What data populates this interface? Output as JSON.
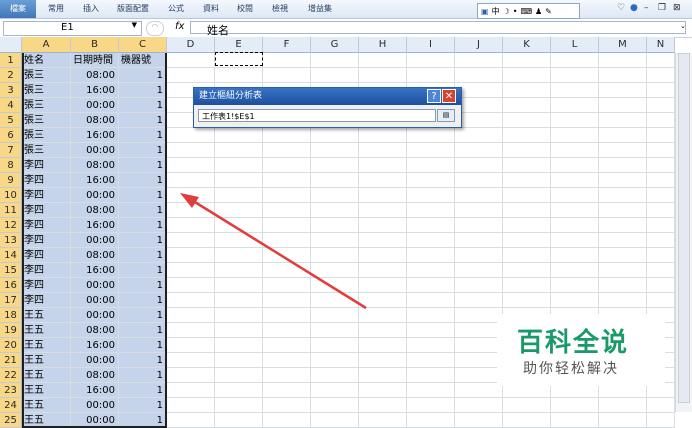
{
  "ribbon": {
    "file_tab": "檔案",
    "tabs": [
      "常用",
      "插入",
      "版面配置",
      "公式",
      "資料",
      "校閱",
      "檢視",
      "增益集"
    ],
    "ime_text": "中"
  },
  "formula_bar": {
    "name_box": "E1",
    "fx": "fx",
    "formula": "姓名"
  },
  "columns": [
    "A",
    "B",
    "C",
    "D",
    "E",
    "F",
    "G",
    "H",
    "I",
    "J",
    "K",
    "L",
    "M",
    "N"
  ],
  "rows": [
    {
      "num": "1",
      "name": "姓名",
      "time": "日期時間",
      "machine": "機器號"
    },
    {
      "num": "2",
      "name": "張三",
      "time": "08:00",
      "machine": "1"
    },
    {
      "num": "3",
      "name": "張三",
      "time": "16:00",
      "machine": "1"
    },
    {
      "num": "4",
      "name": "張三",
      "time": "00:00",
      "machine": "1"
    },
    {
      "num": "5",
      "name": "張三",
      "time": "08:00",
      "machine": "1"
    },
    {
      "num": "6",
      "name": "張三",
      "time": "16:00",
      "machine": "1"
    },
    {
      "num": "7",
      "name": "張三",
      "time": "00:00",
      "machine": "1"
    },
    {
      "num": "8",
      "name": "李四",
      "time": "08:00",
      "machine": "1"
    },
    {
      "num": "9",
      "name": "李四",
      "time": "16:00",
      "machine": "1"
    },
    {
      "num": "10",
      "name": "李四",
      "time": "00:00",
      "machine": "1"
    },
    {
      "num": "11",
      "name": "李四",
      "time": "08:00",
      "machine": "1"
    },
    {
      "num": "12",
      "name": "李四",
      "time": "16:00",
      "machine": "1"
    },
    {
      "num": "13",
      "name": "李四",
      "time": "00:00",
      "machine": "1"
    },
    {
      "num": "14",
      "name": "李四",
      "time": "08:00",
      "machine": "1"
    },
    {
      "num": "15",
      "name": "李四",
      "time": "16:00",
      "machine": "1"
    },
    {
      "num": "16",
      "name": "李四",
      "time": "00:00",
      "machine": "1"
    },
    {
      "num": "17",
      "name": "李四",
      "time": "00:00",
      "machine": "1"
    },
    {
      "num": "18",
      "name": "王五",
      "time": "00:00",
      "machine": "1"
    },
    {
      "num": "19",
      "name": "王五",
      "time": "08:00",
      "machine": "1"
    },
    {
      "num": "20",
      "name": "王五",
      "time": "16:00",
      "machine": "1"
    },
    {
      "num": "21",
      "name": "王五",
      "time": "00:00",
      "machine": "1"
    },
    {
      "num": "22",
      "name": "王五",
      "time": "08:00",
      "machine": "1"
    },
    {
      "num": "23",
      "name": "王五",
      "time": "16:00",
      "machine": "1"
    },
    {
      "num": "24",
      "name": "王五",
      "time": "00:00",
      "machine": "1"
    },
    {
      "num": "25",
      "name": "王五",
      "time": "00:00",
      "machine": "1"
    }
  ],
  "dialog": {
    "title": "建立樞紐分析表",
    "input_value": "工作表1!$E$1",
    "help": "?",
    "close": "✕"
  },
  "watermark": {
    "title": "百科全说",
    "subtitle": "助你轻松解决"
  },
  "colors": {
    "selection": "#c5d4ea",
    "header_selected": "#f8d887",
    "arrow": "#e23c3c",
    "watermark": "#1a9a68"
  }
}
